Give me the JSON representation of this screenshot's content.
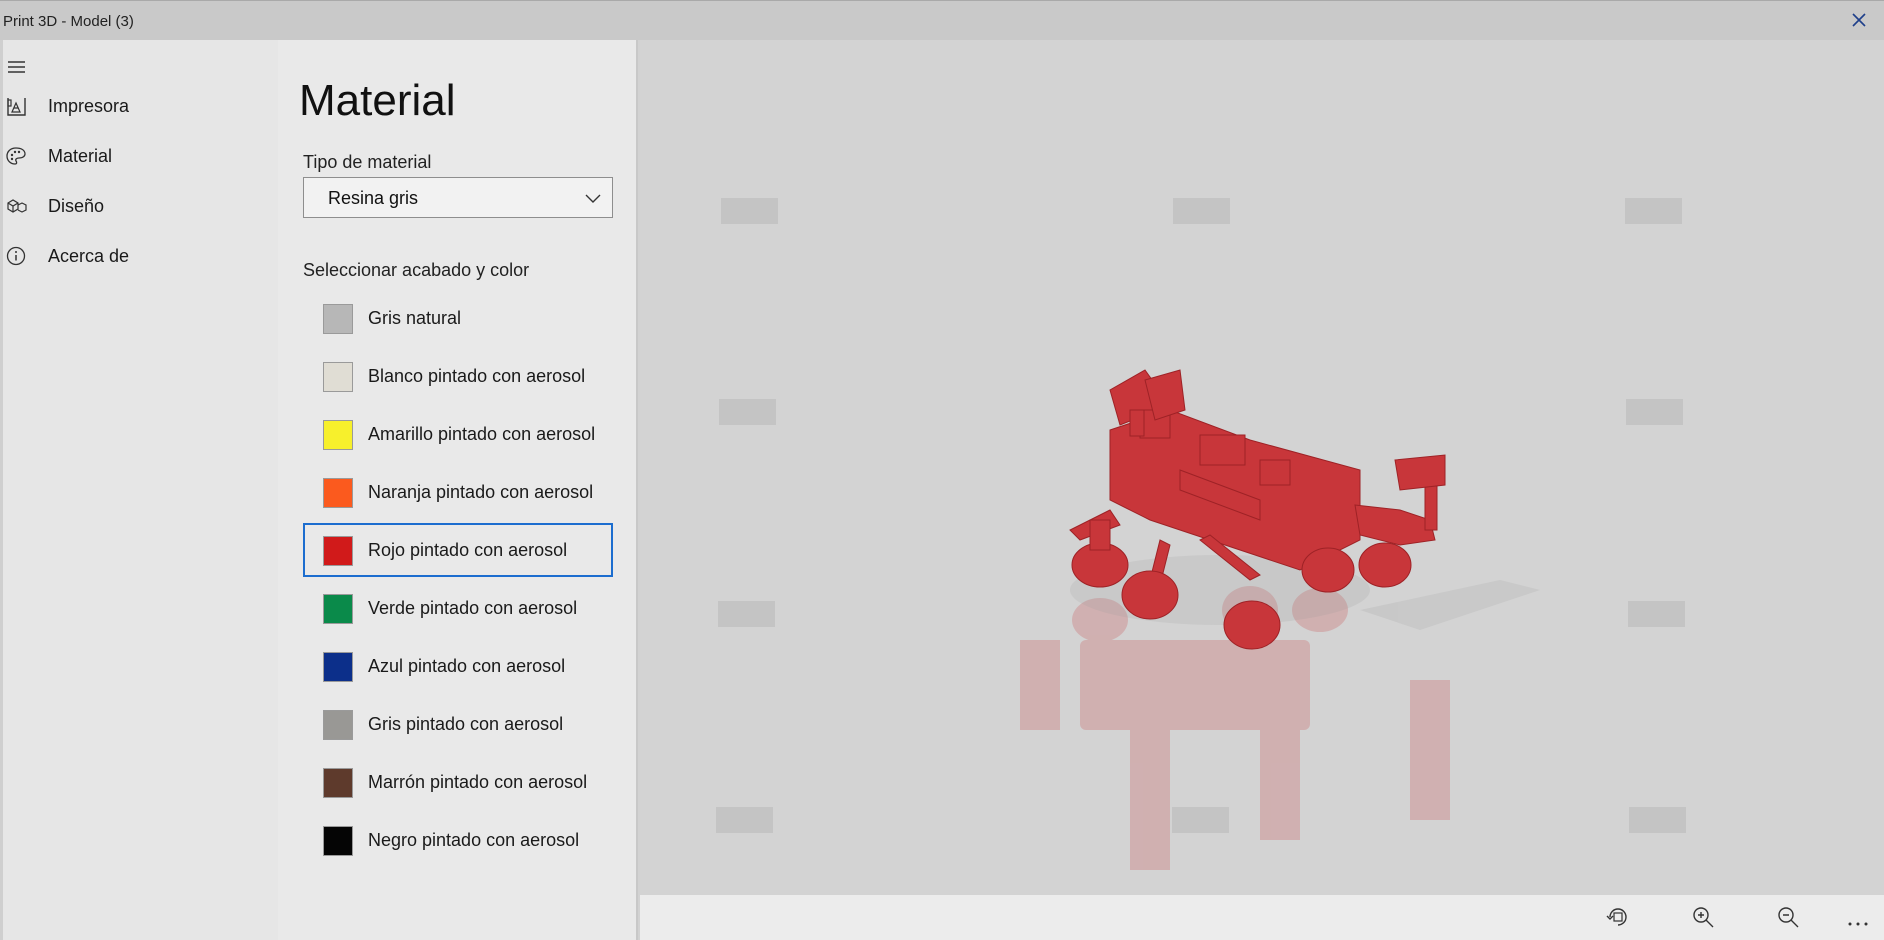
{
  "window": {
    "title": "Print 3D - Model (3)"
  },
  "nav": {
    "items": [
      {
        "label": "Impresora",
        "icon": "printer-icon"
      },
      {
        "label": "Material",
        "icon": "palette-icon"
      },
      {
        "label": "Diseño",
        "icon": "cubes-icon"
      },
      {
        "label": "Acerca de",
        "icon": "info-icon"
      }
    ]
  },
  "panel": {
    "heading": "Material",
    "type_label": "Tipo de material",
    "type_value": "Resina gris",
    "finish_label": "Seleccionar acabado y color",
    "selected_index": 4,
    "finishes": [
      {
        "label": "Gris natural",
        "color": "#b7b7b7"
      },
      {
        "label": "Blanco pintado con aerosol",
        "color": "#e0ddd4"
      },
      {
        "label": "Amarillo pintado con aerosol",
        "color": "#f7f02c"
      },
      {
        "label": "Naranja pintado con aerosol",
        "color": "#fb5a1e"
      },
      {
        "label": "Rojo pintado con aerosol",
        "color": "#d11a1a"
      },
      {
        "label": "Verde pintado con aerosol",
        "color": "#0a8a4a"
      },
      {
        "label": "Azul pintado con aerosol",
        "color": "#0c2f8a"
      },
      {
        "label": "Gris pintado con aerosol",
        "color": "#999895"
      },
      {
        "label": "Marrón pintado con aerosol",
        "color": "#5e3a2c"
      },
      {
        "label": "Negro pintado con aerosol",
        "color": "#050505"
      }
    ]
  },
  "toolbar": {
    "buttons": [
      "rotate-view-icon",
      "zoom-in-icon",
      "zoom-out-icon",
      "more-icon"
    ]
  },
  "colors": {
    "model": "#c8363a",
    "accent": "#1c6dcf"
  }
}
